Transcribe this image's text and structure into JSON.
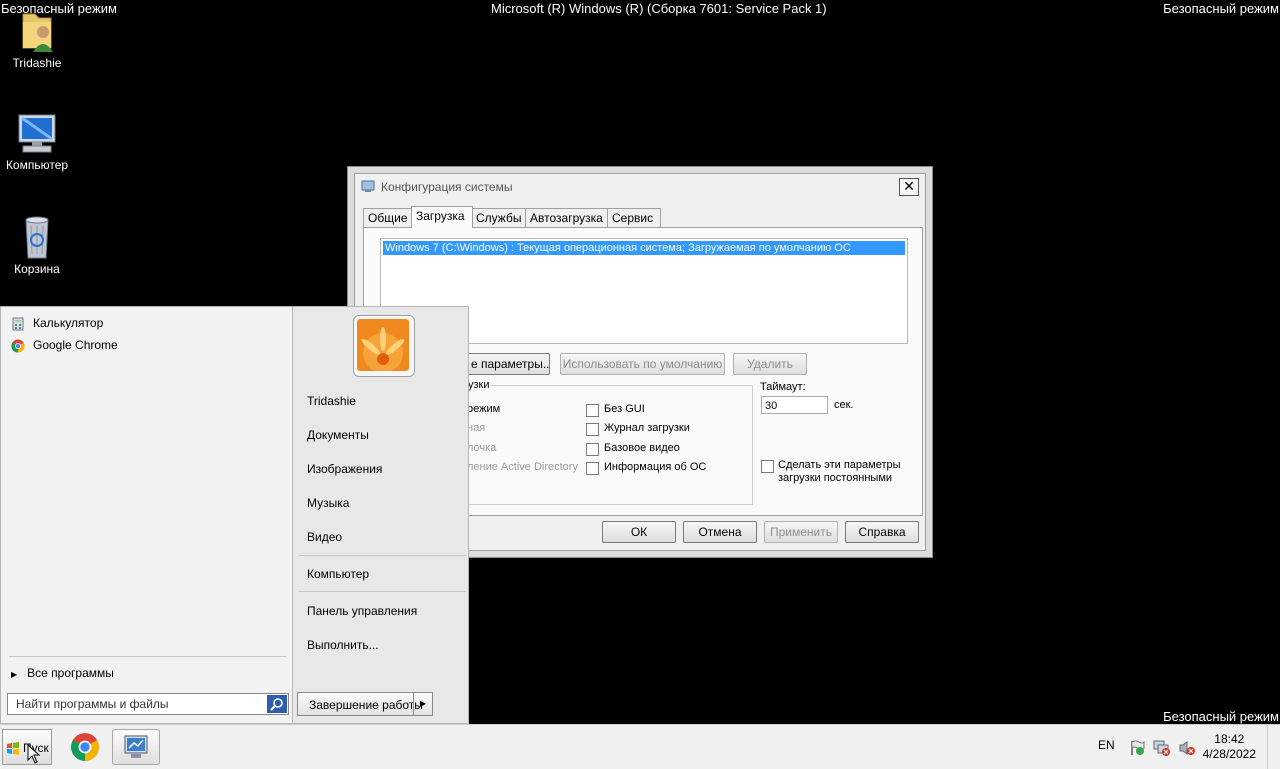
{
  "watermark": {
    "top_left": "Безопасный режим",
    "top_center": "Microsoft (R) Windows (R) (Сборка 7601: Service Pack 1)",
    "top_right": "Безопасный режим",
    "bottom_right": "Безопасный режим"
  },
  "desktop": {
    "icons": [
      {
        "label": "Tridashie",
        "icon": "user-folder-icon"
      },
      {
        "label": "Компьютер",
        "icon": "computer-icon"
      },
      {
        "label": "Корзина",
        "icon": "recycle-bin-icon"
      }
    ]
  },
  "dialog": {
    "title": "Конфигурация системы",
    "tabs": [
      "Общие",
      "Загрузка",
      "Службы",
      "Автозагрузка",
      "Сервис"
    ],
    "active_tab": "Загрузка",
    "os_entry": "Windows 7 (C:\\Windows) : Текущая операционная система; Загружаемая по умолчанию ОС",
    "btn_advanced": "е параметры...",
    "btn_default": "Использовать по умолчанию",
    "btn_delete": "Удалить",
    "group_label": "узки",
    "options_left": [
      "режим",
      "ная",
      "лочка",
      "ление Active Directory"
    ],
    "options_right": [
      "Без GUI",
      "Журнал загрузки",
      "Базовое видео",
      "Информация  об ОС"
    ],
    "timeout_label": "Таймаут:",
    "timeout_value": "30",
    "timeout_unit": "сек.",
    "make_permanent": "Сделать эти параметры загрузки постоянными",
    "btn_ok": "ОК",
    "btn_cancel": "Отмена",
    "btn_apply": "Применить",
    "btn_help": "Справка"
  },
  "start_menu": {
    "programs": [
      {
        "label": "Калькулятор",
        "icon": "calculator-icon"
      },
      {
        "label": "Google Chrome",
        "icon": "chrome-icon"
      }
    ],
    "right_items": [
      "Tridashie",
      "Документы",
      "Изображения",
      "Музыка",
      "Видео",
      "Компьютер",
      "Панель управления",
      "Выполнить..."
    ],
    "all_programs": "Все программы",
    "search_placeholder": "Найти программы и файлы",
    "shutdown": "Завершение работы"
  },
  "taskbar": {
    "start_label": "Пуск",
    "language": "EN",
    "time": "18:42",
    "date": "4/28/2022"
  },
  "colors": {
    "selection": "#3399ff",
    "desktop": "#000000",
    "taskbar": "#f0f0f0"
  }
}
